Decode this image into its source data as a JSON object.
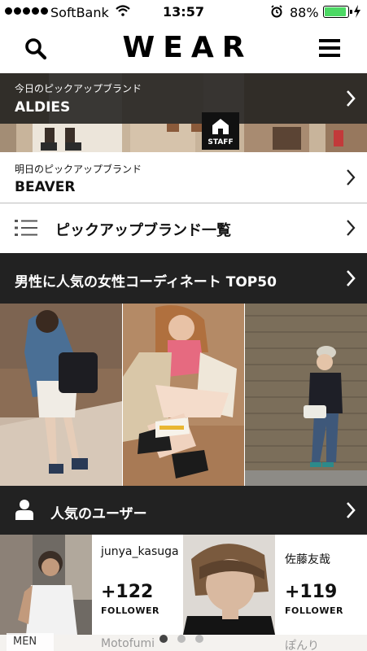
{
  "status_bar": {
    "carrier": "SoftBank",
    "time": "13:57",
    "battery": "88%",
    "battery_level": 0.88
  },
  "header": {
    "logo": "WEAR",
    "search_icon": "search-icon",
    "menu_icon": "hamburger-menu-icon"
  },
  "pickup_today": {
    "label": "今日のピックアップブランド",
    "brand": "ALDIES",
    "staff_badge": "STAFF"
  },
  "pickup_tomorrow": {
    "label": "明日のピックアップブランド",
    "brand": "BEAVER"
  },
  "brand_list": {
    "label": "ピックアップブランド一覧",
    "icon": "list-icon"
  },
  "coordinates_section": {
    "title": "男性に人気の女性コーディネート TOP50"
  },
  "users_section": {
    "title": "人気のユーザー",
    "icon": "person-icon"
  },
  "users": [
    {
      "name": "junya_kasuga",
      "followers": "+122",
      "follower_label": "FOLLOWER"
    },
    {
      "name": "佐藤友哉",
      "followers": "+119",
      "follower_label": "FOLLOWER"
    }
  ],
  "peek": {
    "tag": "MEN",
    "name_left": "Motofumi",
    "name_right": "ぽんり"
  },
  "pager": {
    "count": 3,
    "active": 1
  },
  "colors": {
    "dark_bar": "#222222",
    "battery": "#4cd964"
  }
}
